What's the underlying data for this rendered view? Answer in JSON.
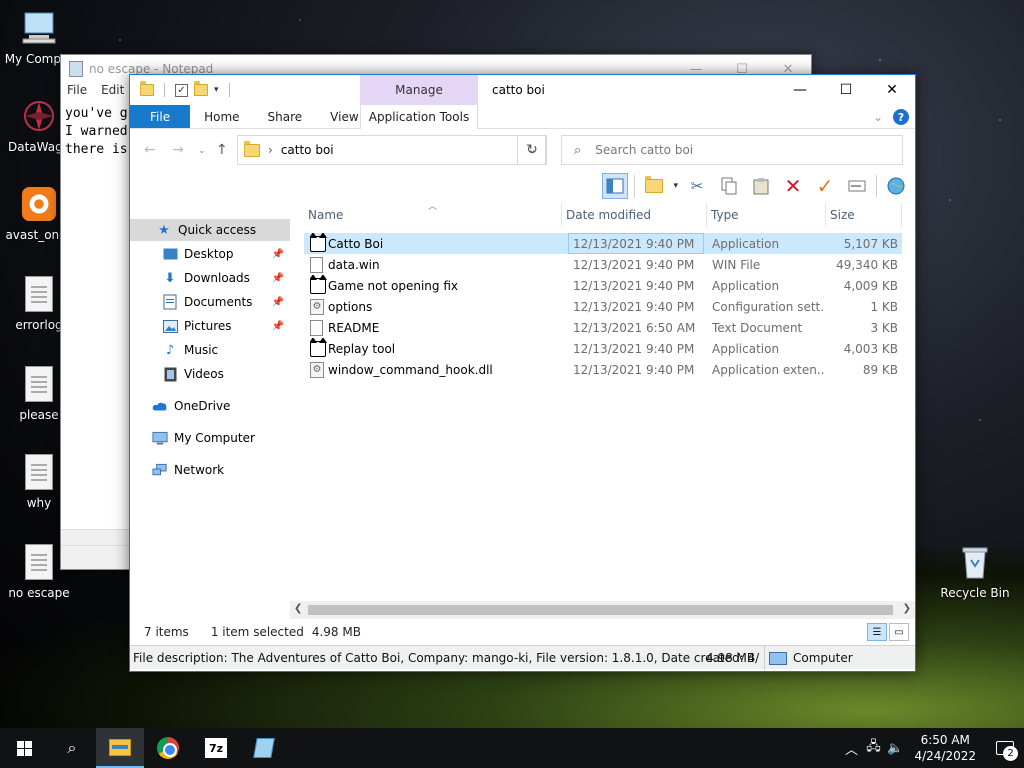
{
  "desktop": {
    "icons": [
      {
        "label": "My Comput",
        "icon": "computer-icon"
      },
      {
        "label": "DataWago",
        "icon": "datawago-icon"
      },
      {
        "label": "avast_one_",
        "icon": "avast-icon"
      },
      {
        "label": "errorlog",
        "icon": "document-icon"
      },
      {
        "label": "please",
        "icon": "document-icon"
      },
      {
        "label": "why",
        "icon": "document-icon"
      },
      {
        "label": "no escape",
        "icon": "document-icon"
      },
      {
        "label": "Recycle Bin",
        "icon": "recycle-bin-icon"
      }
    ]
  },
  "notepad": {
    "title": "no escape - Notepad",
    "menu": [
      "File",
      "Edit"
    ],
    "lines": [
      "you've g",
      "I warned",
      "there is"
    ]
  },
  "explorer": {
    "title": "catto boi",
    "manage_tab": "Manage",
    "ribbon_tabs": [
      "File",
      "Home",
      "Share",
      "View"
    ],
    "app_tools_tab": "Application Tools",
    "address": "catto boi",
    "search_placeholder": "Search catto boi",
    "nav": [
      {
        "label": "Quick access",
        "icon": "star-icon",
        "pinned": false,
        "selected": true
      },
      {
        "label": "Desktop",
        "icon": "desktop-icon",
        "pinned": true
      },
      {
        "label": "Downloads",
        "icon": "download-icon",
        "pinned": true
      },
      {
        "label": "Documents",
        "icon": "documents-icon",
        "pinned": true
      },
      {
        "label": "Pictures",
        "icon": "pictures-icon",
        "pinned": true
      },
      {
        "label": "Music",
        "icon": "music-icon",
        "pinned": false
      },
      {
        "label": "Videos",
        "icon": "videos-icon",
        "pinned": false
      },
      {
        "label": "OneDrive",
        "icon": "cloud-icon",
        "pinned": false
      },
      {
        "label": "My Computer",
        "icon": "computer-icon",
        "pinned": false
      },
      {
        "label": "Network",
        "icon": "network-icon",
        "pinned": false
      }
    ],
    "columns": [
      "Name",
      "Date modified",
      "Type",
      "Size"
    ],
    "files": [
      {
        "name": "Catto Boi",
        "date": "12/13/2021 9:40 PM",
        "type": "Application",
        "size": "5,107 KB",
        "icon": "cat-icon",
        "selected": true
      },
      {
        "name": "data.win",
        "date": "12/13/2021 9:40 PM",
        "type": "WIN File",
        "size": "49,340 KB",
        "icon": "file-icon"
      },
      {
        "name": "Game not opening fix",
        "date": "12/13/2021 9:40 PM",
        "type": "Application",
        "size": "4,009 KB",
        "icon": "cat-icon"
      },
      {
        "name": "options",
        "date": "12/13/2021 9:40 PM",
        "type": "Configuration sett...",
        "size": "1 KB",
        "icon": "settings-file-icon"
      },
      {
        "name": "README",
        "date": "12/13/2021 6:50 AM",
        "type": "Text Document",
        "size": "3 KB",
        "icon": "file-icon"
      },
      {
        "name": "Replay tool",
        "date": "12/13/2021 9:40 PM",
        "type": "Application",
        "size": "4,003 KB",
        "icon": "cat-icon"
      },
      {
        "name": "window_command_hook.dll",
        "date": "12/13/2021 9:40 PM",
        "type": "Application exten...",
        "size": "89 KB",
        "icon": "dll-icon"
      }
    ],
    "status": {
      "items": "7 items",
      "selected": "1 item selected",
      "size": "4.98 MB"
    },
    "info_bar": {
      "description": "File description: The Adventures of Catto Boi, Company: mango-ki, File version: 1.8.1.0, Date created: 4/",
      "size": "4.98 MB",
      "location": "Computer"
    }
  },
  "taskbar": {
    "time": "6:50 AM",
    "date": "4/24/2022",
    "notifications": "2"
  },
  "colors": {
    "accent": "#1979ca",
    "selection": "#cce8ff",
    "manage_tab": "#e6d6f5"
  }
}
